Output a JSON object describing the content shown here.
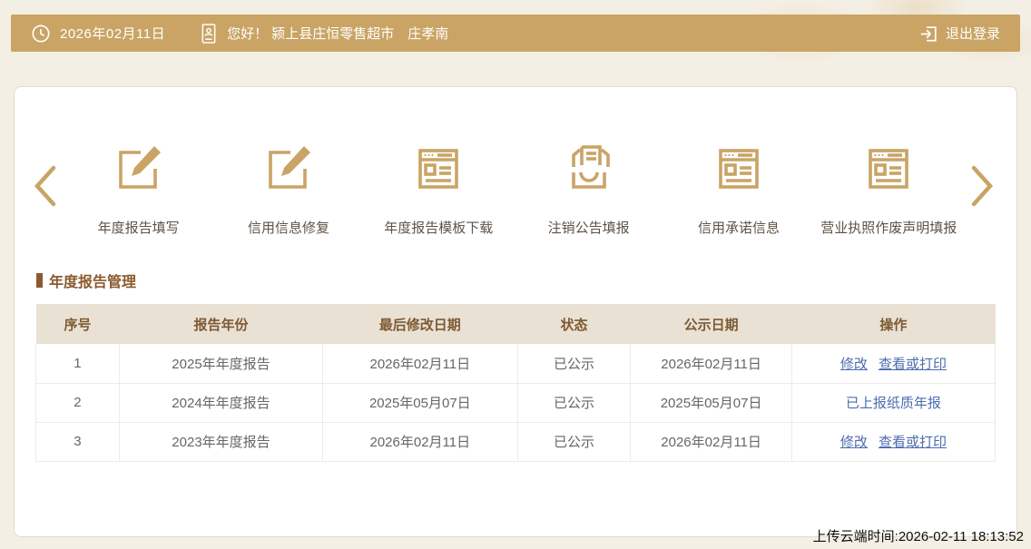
{
  "colors": {
    "accent_gold": "#c9a465",
    "link_blue": "#4e6cb0",
    "header_text_brown": "#7d5a33",
    "section_title_brown": "#8a5a2e",
    "page_background": "#f4efe4",
    "table_header_bg": "#e9e1d4"
  },
  "topbar": {
    "date": "2026年02月11日",
    "greeting": "您好！ 颍上县庄恒零售超市　庄孝南",
    "logout_label": "退出登录"
  },
  "carousel": {
    "items": [
      {
        "label": "年度报告填写",
        "icon": "edit-icon"
      },
      {
        "label": "信用信息修复",
        "icon": "edit-icon"
      },
      {
        "label": "年度报告模板下载",
        "icon": "form-icon"
      },
      {
        "label": "注销公告填报",
        "icon": "inbox-icon"
      },
      {
        "label": "信用承诺信息",
        "icon": "form-icon"
      },
      {
        "label": "营业执照作废声明填报",
        "icon": "form-icon"
      }
    ]
  },
  "section": {
    "title": "年度报告管理"
  },
  "table": {
    "headers": [
      "序号",
      "报告年份",
      "最后修改日期",
      "状态",
      "公示日期",
      "操作"
    ],
    "rows": [
      {
        "seq": "1",
        "year": "2025年年度报告",
        "modified": "2026年02月11日",
        "status": "已公示",
        "publish": "2026年02月11日",
        "actions": [
          {
            "label": "修改",
            "underlined": true
          },
          {
            "label": "查看或打印",
            "underlined": true
          }
        ]
      },
      {
        "seq": "2",
        "year": "2024年年度报告",
        "modified": "2025年05月07日",
        "status": "已公示",
        "publish": "2025年05月07日",
        "actions": [
          {
            "label": "已上报纸质年报",
            "underlined": false
          }
        ]
      },
      {
        "seq": "3",
        "year": "2023年年度报告",
        "modified": "2026年02月11日",
        "status": "已公示",
        "publish": "2026年02月11日",
        "actions": [
          {
            "label": "修改",
            "underlined": true
          },
          {
            "label": "查看或打印",
            "underlined": true
          }
        ]
      }
    ]
  },
  "footer": {
    "upload_time": "上传云端时间:2026-02-11 18:13:52"
  }
}
